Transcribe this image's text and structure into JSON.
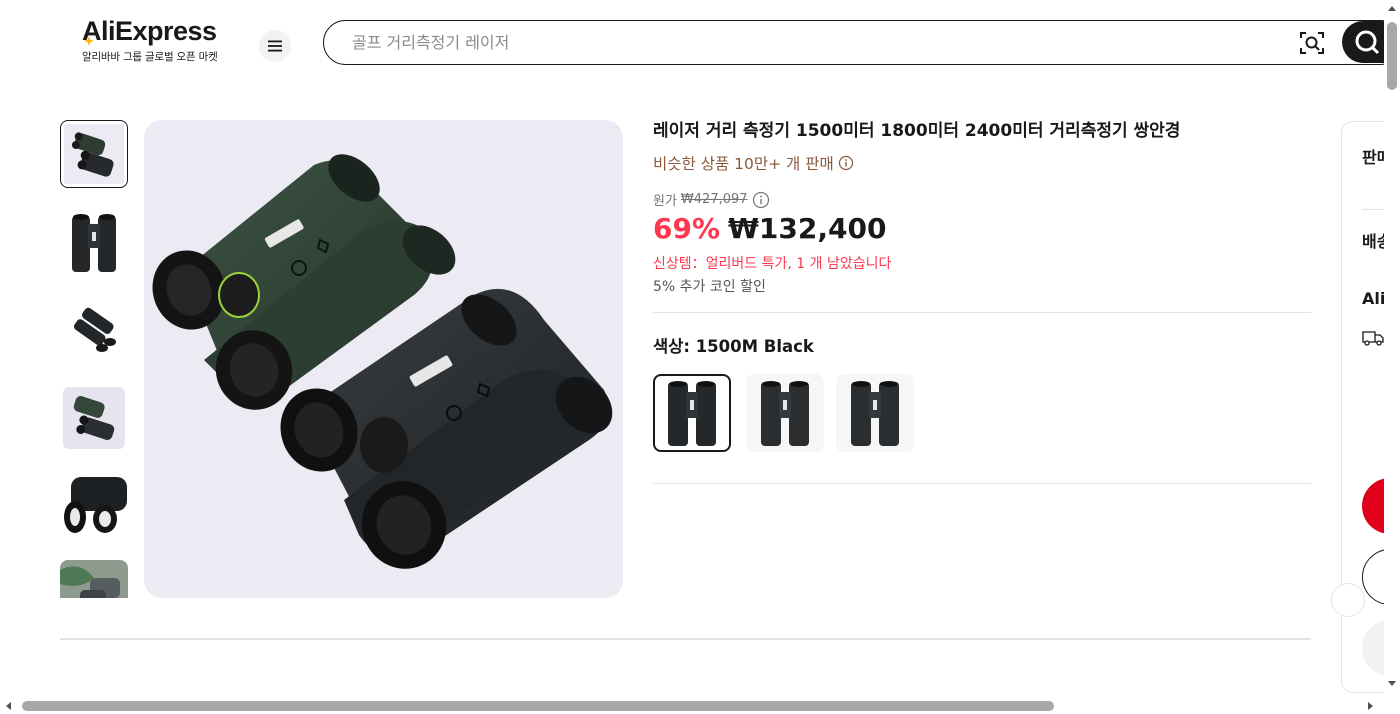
{
  "header": {
    "logo_text": "AliExpress",
    "logo_tagline": "알리바바 그룹 글로벌 오픈 마켓",
    "search_placeholder": "골프 거리측정기 레이저"
  },
  "product": {
    "title": "레이저 거리 측정기 1500미터 1800미터 2400미터 거리측정기 쌍안경",
    "sold_text": "비슷한 상품 10만+ 개 판매",
    "original_label": "원가",
    "original_price": "₩427,097",
    "discount": "69%",
    "price": "₩132,400",
    "promo_text": "신상템：얼리버드 특가, 1 개 남았습니다",
    "coin_text": "5% 추가 코인 할인",
    "color_label": "색상: 1500M Black",
    "thumbnail_count": 6,
    "selected_thumbnail": 0,
    "swatch_count": 3,
    "selected_swatch": 0
  },
  "side_panel": {
    "line1": "판매",
    "line2": "배송",
    "line3": "Ali"
  },
  "colors": {
    "accent_red": "#fd384f",
    "brand_dark": "#191919",
    "sold_brown": "#8a5a3c"
  }
}
